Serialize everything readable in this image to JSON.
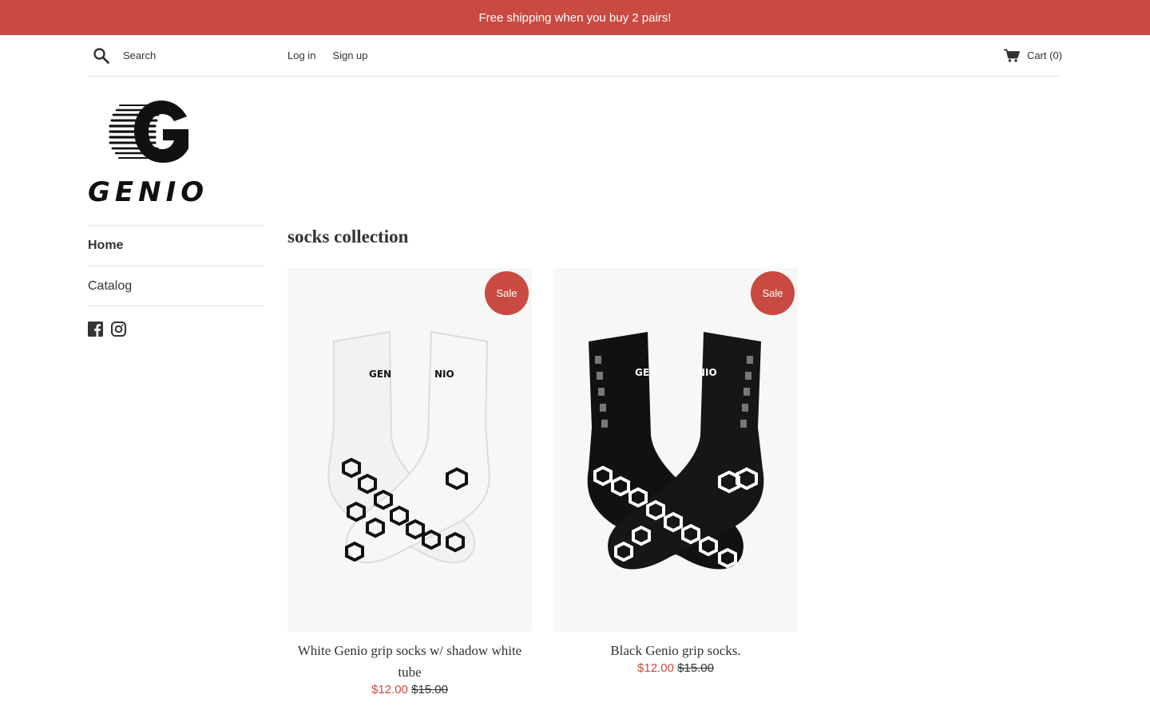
{
  "announcement": {
    "text": "Free shipping when you buy 2 pairs!"
  },
  "header": {
    "search_placeholder": "Search",
    "login_label": "Log in",
    "signup_label": "Sign up",
    "cart_label": "Cart (0)"
  },
  "logo": {
    "text": "GENIO"
  },
  "sidebar": {
    "items": [
      {
        "label": "Home",
        "active": true
      },
      {
        "label": "Catalog",
        "active": false
      }
    ],
    "social_icons": [
      "facebook-icon",
      "instagram-icon"
    ]
  },
  "collection": {
    "title": "socks collection",
    "products": [
      {
        "title": "White Genio grip socks w/ shadow white tube",
        "badge": "Sale",
        "sale_price": "$12.00",
        "compare_price": "$15.00",
        "color": "white"
      },
      {
        "title": "Black Genio grip socks.",
        "badge": "Sale",
        "sale_price": "$12.00",
        "compare_price": "$15.00",
        "color": "black"
      }
    ]
  },
  "colors": {
    "accent": "#c94a40",
    "text": "#333333",
    "divider": "#e2e2e2"
  }
}
